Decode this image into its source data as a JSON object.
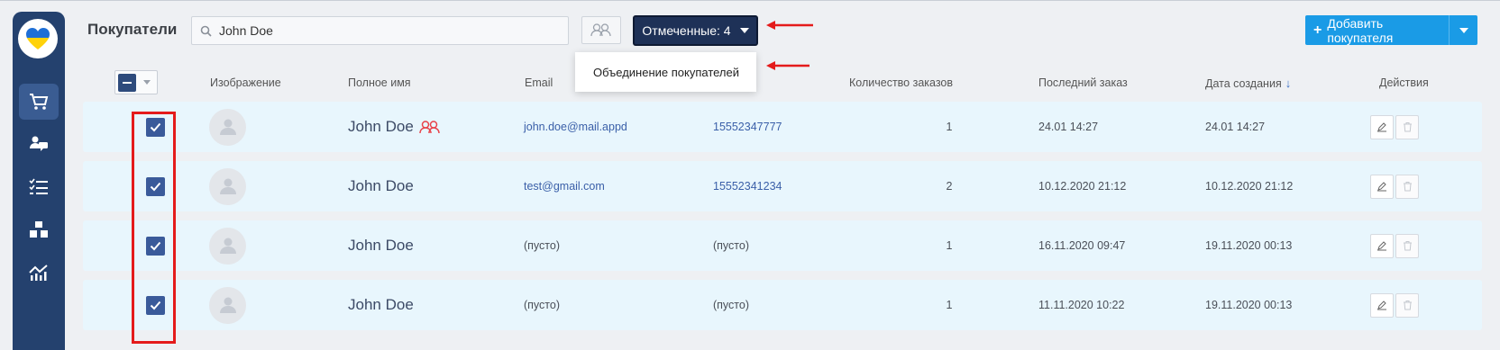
{
  "sidebar": {
    "logo_icon": "ukraine-heart-icon",
    "items": [
      {
        "icon": "cart-icon",
        "active": true
      },
      {
        "icon": "users-chat-icon",
        "active": false
      },
      {
        "icon": "checklist-icon",
        "active": false
      },
      {
        "icon": "boxes-icon",
        "active": false
      },
      {
        "icon": "chart-icon",
        "active": false
      }
    ]
  },
  "header": {
    "title": "Покупатели",
    "search_value": "John Doe",
    "marked_label": "Отмеченные: 4",
    "dropdown_item": "Объединение покупателей",
    "add_label": "Добавить покупателя"
  },
  "columns": {
    "image": "Изображение",
    "full_name": "Полное имя",
    "email": "Email",
    "orders_count": "Количество заказов",
    "last_order": "Последний заказ",
    "created": "Дата создания",
    "actions": "Действия"
  },
  "rows": [
    {
      "name": "John Doe",
      "merged": true,
      "email": "john.doe@mail.appd",
      "phone": "15552347777",
      "orders": "1",
      "last_order": "24.01 14:27",
      "created": "24.01 14:27"
    },
    {
      "name": "John Doe",
      "merged": false,
      "email": "test@gmail.com",
      "phone": "15552341234",
      "orders": "2",
      "last_order": "10.12.2020 21:12",
      "created": "10.12.2020 21:12"
    },
    {
      "name": "John Doe",
      "merged": false,
      "email": "(пусто)",
      "phone": "(пусто)",
      "orders": "1",
      "last_order": "16.11.2020 09:47",
      "created": "19.11.2020 00:13"
    },
    {
      "name": "John Doe",
      "merged": false,
      "email": "(пусто)",
      "phone": "(пусто)",
      "orders": "1",
      "last_order": "11.11.2020 10:22",
      "created": "19.11.2020 00:13"
    }
  ],
  "colors": {
    "sidebar": "#24416e",
    "primary_button": "#1a9be6",
    "marked_button": "#1e3157",
    "row_bg": "#e8f6fd",
    "annotation_red": "#e41b1b"
  }
}
